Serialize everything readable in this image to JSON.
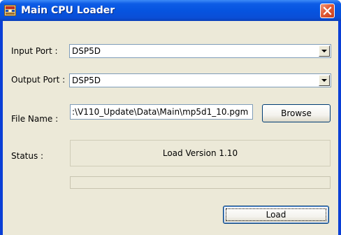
{
  "window": {
    "title": "Main CPU Loader",
    "icons": {
      "app": "app-icon",
      "close": "close-icon"
    }
  },
  "form": {
    "input_port": {
      "label": "Input Port :",
      "value": "DSP5D"
    },
    "output_port": {
      "label": "Output Port :",
      "value": "DSP5D"
    },
    "file_name": {
      "label": "File Name :",
      "value": ":\\V110_Update\\Data\\Main\\mp5d1_10.pgm"
    },
    "browse_label": "Browse",
    "status": {
      "label": "Status :",
      "value": "Load Version 1.10"
    },
    "progress_fraction": 0,
    "load_label": "Load"
  },
  "colors": {
    "titlebar": "#0a4ed6",
    "client_bg": "#ece9d8",
    "close_button": "#e05a36",
    "border": "#7f9db9"
  }
}
